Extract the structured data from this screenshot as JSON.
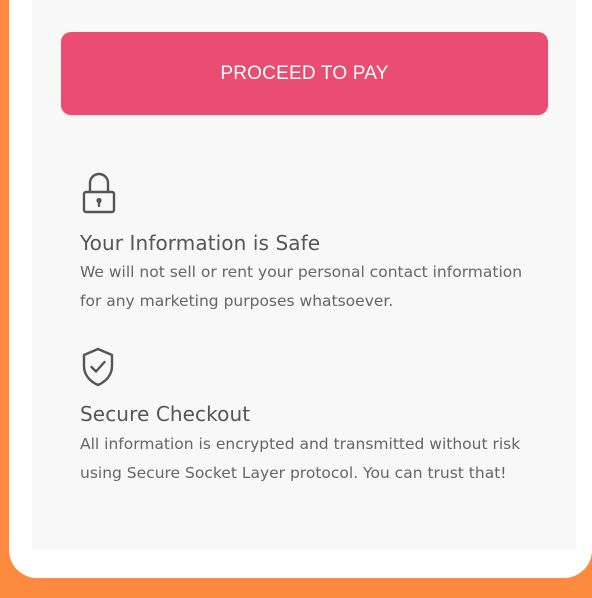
{
  "checkout": {
    "pay_button_label": "PROCEED TO PAY"
  },
  "assurances": [
    {
      "icon": "lock-icon",
      "title": "Your Information is Safe",
      "description": "We will not sell or rent your personal contact information for any marketing purposes whatsoever."
    },
    {
      "icon": "shield-check-icon",
      "title": "Secure Checkout",
      "description": "All information is encrypted and transmitted without risk using Secure Socket Layer protocol. You can trust that!"
    }
  ],
  "colors": {
    "page_background": "#fe8a3f",
    "card_background": "#ffffff",
    "panel_background": "#f8f8f8",
    "pay_button": "#ea4c72",
    "pay_button_text": "#ffffff",
    "heading_text": "#555555",
    "body_text": "#666666",
    "icon_stroke": "#555555"
  }
}
